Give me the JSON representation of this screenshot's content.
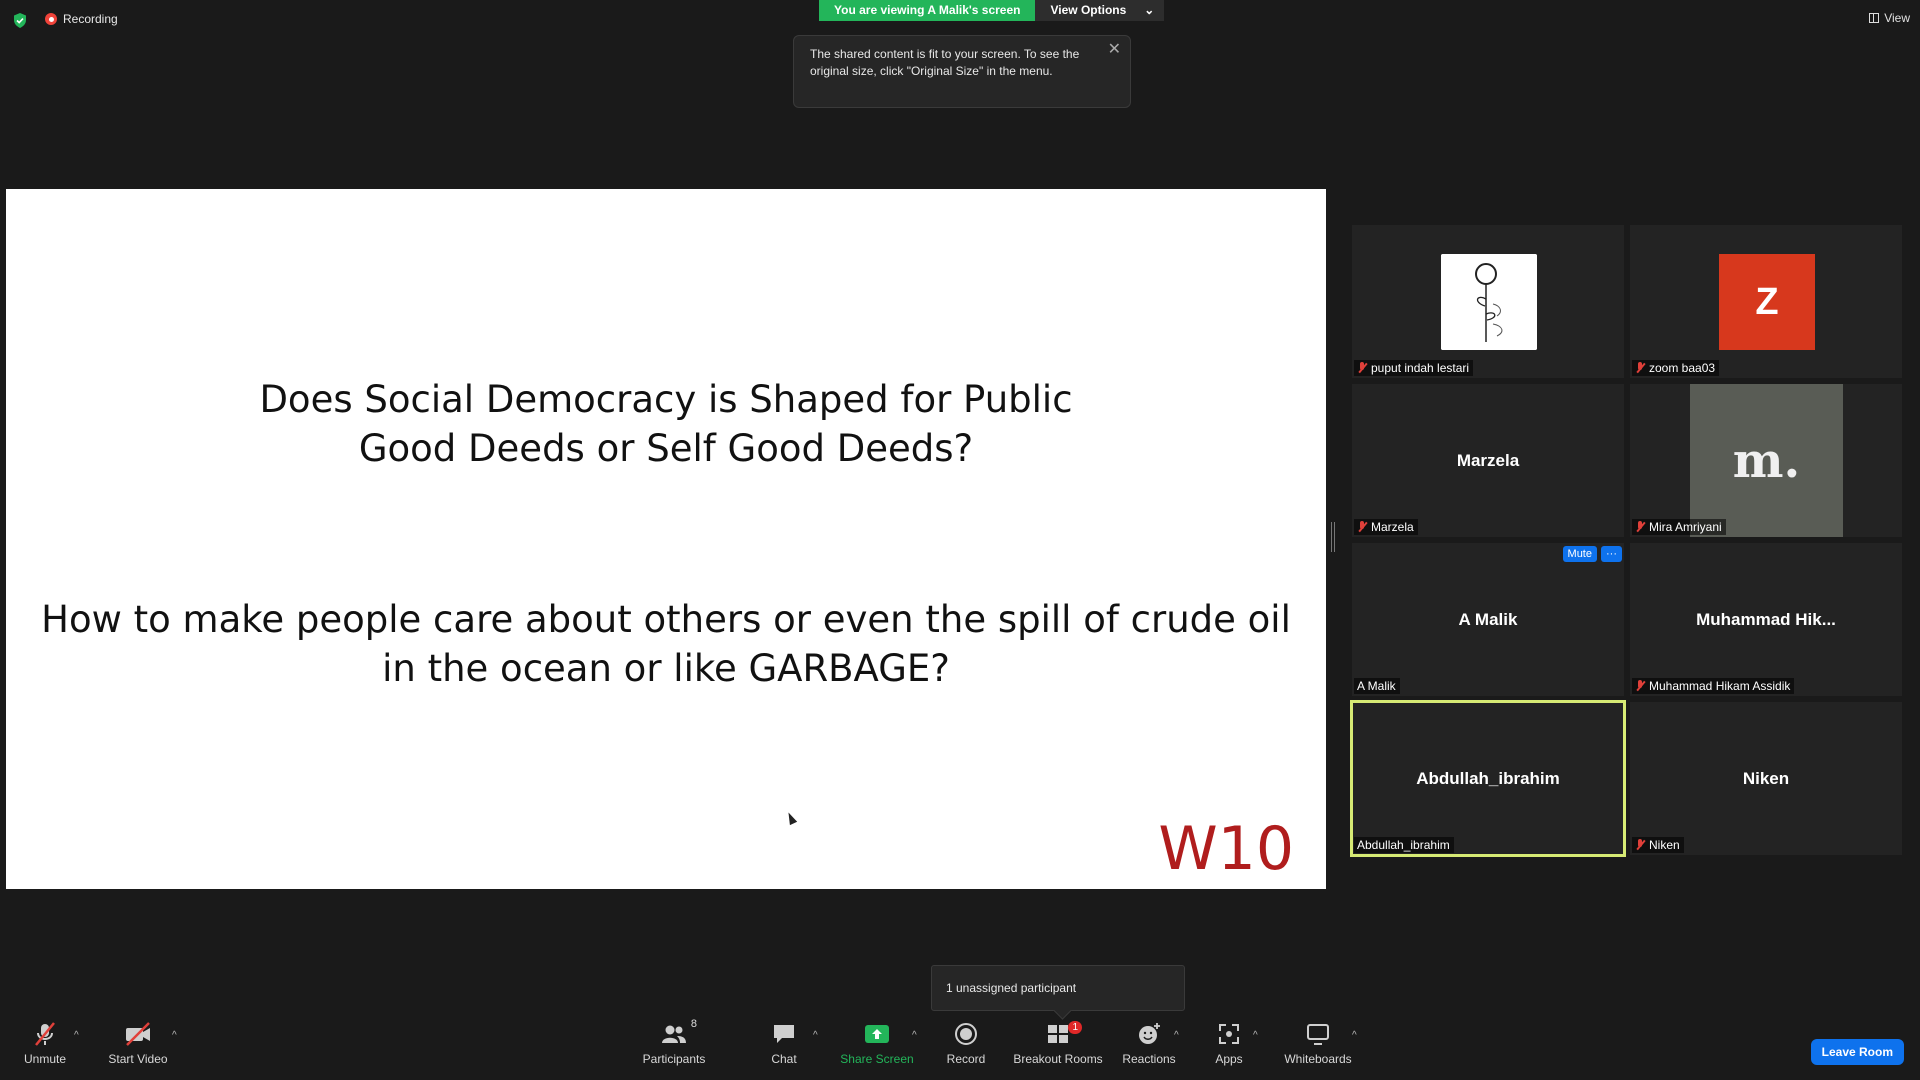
{
  "top": {
    "recording_label": "Recording",
    "viewing_label": "You are viewing A Malik's screen",
    "view_options_label": "View Options",
    "toast_text": "The shared content is fit to your screen. To see the original size, click \"Original Size\" in the menu.",
    "view_label": "View"
  },
  "slide": {
    "question1_line1": "Does Social Democracy is Shaped for Public",
    "question1_line2": "Good Deeds or Self Good Deeds?",
    "question2_line1": "How to make people care about others or even the spill of crude oil",
    "question2_line2": "in the ocean or like GARBAGE?",
    "tag": "W10"
  },
  "participants": [
    {
      "label": "puput indah lestari",
      "display": "",
      "muted": true,
      "avatar": "drawing-image"
    },
    {
      "label": "zoom baa03",
      "display": "Z",
      "muted": true,
      "avatar": "letter",
      "color": "#d7381d"
    },
    {
      "label": "Marzela",
      "display": "Marzela",
      "muted": true,
      "avatar": "name"
    },
    {
      "label": "Mira Amriyani",
      "display": "m.",
      "muted": true,
      "avatar": "logo-image"
    },
    {
      "label": "A Malik",
      "display": "A Malik",
      "muted": false,
      "avatar": "name",
      "mute_button": "Mute",
      "more_button": "···"
    },
    {
      "label": "Muhammad Hikam Assidik",
      "display": "Muhammad  Hik...",
      "muted": true,
      "avatar": "name"
    },
    {
      "label": "Abdullah_ibrahim",
      "display": "Abdullah_ibrahim",
      "muted": false,
      "avatar": "name",
      "active_speaker": true
    },
    {
      "label": "Niken",
      "display": "Niken",
      "muted": true,
      "avatar": "name"
    }
  ],
  "tooltip": "1 unassigned participant",
  "toolbar": {
    "unmute": "Unmute",
    "start_video": "Start Video",
    "participants": "Participants",
    "participants_count": "8",
    "chat": "Chat",
    "share_screen": "Share Screen",
    "record": "Record",
    "breakout_rooms": "Breakout Rooms",
    "breakout_badge": "1",
    "reactions": "Reactions",
    "apps": "Apps",
    "whiteboards": "Whiteboards",
    "leave_room": "Leave Room"
  },
  "colors": {
    "share_green": "#23b55a",
    "accent_blue": "#0e72ed",
    "active_speaker": "#d6ea74",
    "muted_red": "#e0403a"
  }
}
